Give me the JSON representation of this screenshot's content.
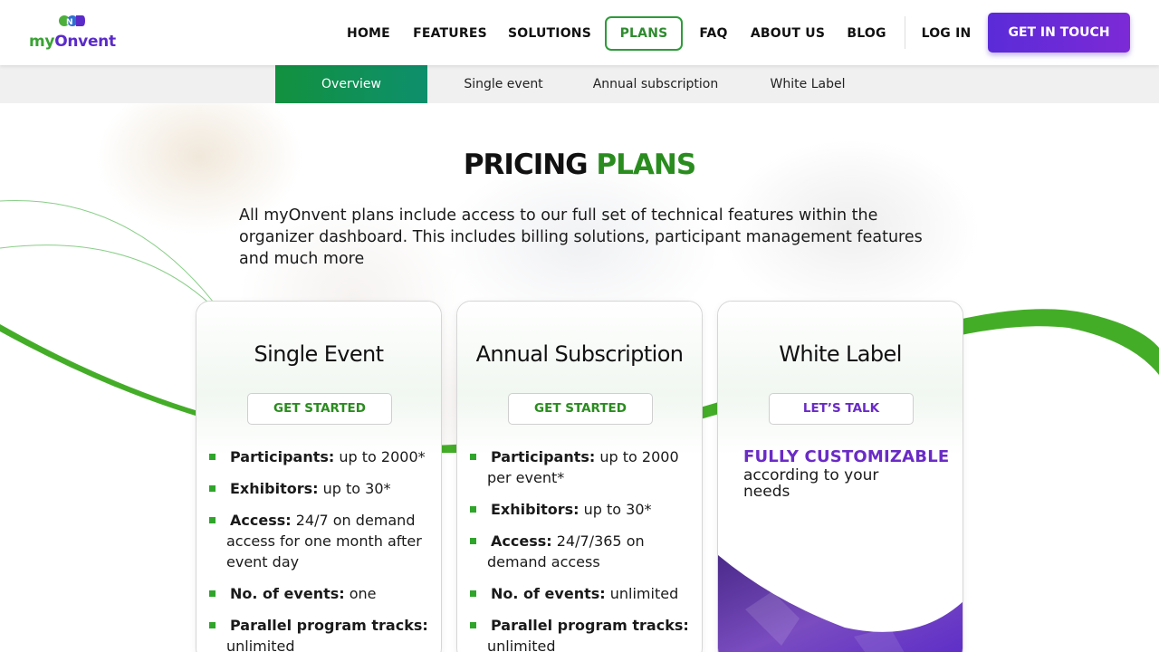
{
  "brand": {
    "logo_prefix": "my",
    "logo_suffix": "Onvent",
    "colors": {
      "green": "#2a8c1f",
      "purple": "#6a2bc6"
    }
  },
  "nav": {
    "items": [
      "HOME",
      "FEATURES",
      "SOLUTIONS",
      "PLANS",
      "FAQ",
      "ABOUT US",
      "BLOG"
    ],
    "active": "PLANS",
    "login": "LOG IN",
    "cta": "GET IN TOUCH"
  },
  "subnav": {
    "tabs": [
      "Overview",
      "Single event",
      "Annual subscription",
      "White Label"
    ],
    "active": "Overview"
  },
  "hero": {
    "title_part1": "PRICING ",
    "title_part2": "PLANS",
    "intro": "All myOnvent plans include access to our full set of technical features within the organizer dashboard. This includes billing solutions, participant management features and much more"
  },
  "plans": [
    {
      "title": "Single Event",
      "button": "GET STARTED",
      "features": [
        {
          "label": "Participants:",
          "value": "up to 2000*"
        },
        {
          "label": "Exhibitors:",
          "value": "up to 30*"
        },
        {
          "label": "Access:",
          "value": "24/7 on demand access for one month after event day"
        },
        {
          "label": "No. of events:",
          "value": "one"
        },
        {
          "label": "Parallel program tracks:",
          "value": "unlimited"
        }
      ]
    },
    {
      "title": "Annual Subscription",
      "button": "GET STARTED",
      "features": [
        {
          "label": "Participants:",
          "value": "up to 2000 per event*"
        },
        {
          "label": "Exhibitors:",
          "value": "up to 30*"
        },
        {
          "label": "Access:",
          "value": "24/7/365 on demand access"
        },
        {
          "label": "No. of events:",
          "value": "unlimited"
        },
        {
          "label": "Parallel program tracks:",
          "value": "unlimited"
        }
      ]
    },
    {
      "title": "White Label",
      "button": "LET’S TALK",
      "headline": "FULLY CUSTOMIZABLE",
      "text": "according to your needs"
    }
  ]
}
